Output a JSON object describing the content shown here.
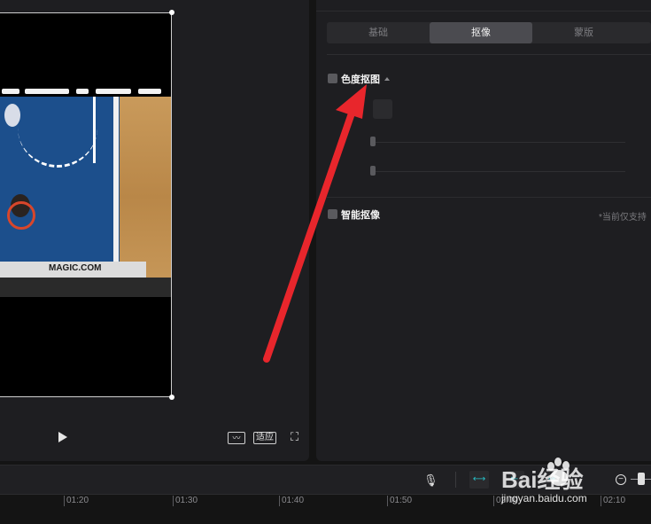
{
  "preview": {
    "banner_text": "MAGIC.COM",
    "fit_label": "适应",
    "icons": {
      "play": "play-icon",
      "waveform": "waveform-icon",
      "fullscreen": "fullscreen-icon"
    }
  },
  "inspector": {
    "tabs": [
      {
        "label": "基础",
        "active": false
      },
      {
        "label": "抠像",
        "active": true
      },
      {
        "label": "蒙版",
        "active": false
      }
    ],
    "chroma_key": {
      "label": "色度抠图",
      "checked": false
    },
    "smart_cutout": {
      "label": "智能抠像",
      "checked": false,
      "note": "*当前仅支持"
    }
  },
  "toolbar": {
    "icons": [
      "mic-icon",
      "link-icon",
      "split-icon",
      "snap-icon",
      "zoom-out-icon"
    ]
  },
  "timeline": {
    "ticks": [
      "01:20",
      "01:30",
      "01:40",
      "01:50",
      "02:00",
      "02:10"
    ]
  },
  "annotation": {
    "arrow_color": "#e8262c"
  },
  "watermark": {
    "logo": "Bai经验",
    "url": "jingyan.baidu.com"
  }
}
